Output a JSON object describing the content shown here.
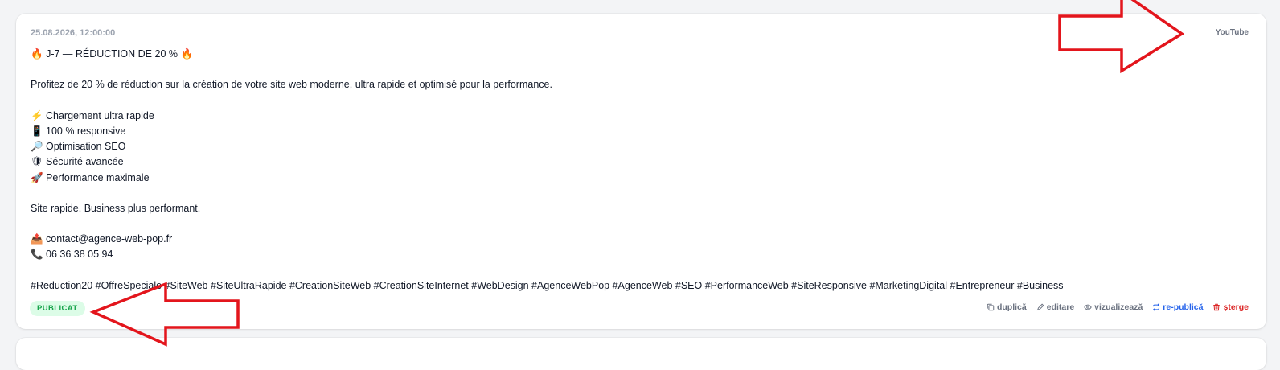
{
  "post": {
    "date": "25.08.2026, 12:00:00",
    "platform": "YouTube",
    "title": "J-7 — RÉDUCTION DE 20 %",
    "title_emoji": "🔥",
    "intro": "Profitez de 20 % de réduction sur la création de votre site web moderne, ultra rapide et optimisé pour la performance.",
    "features": [
      {
        "emoji": "⚡",
        "text": "Chargement ultra rapide"
      },
      {
        "emoji": "📱",
        "text": "100 % responsive"
      },
      {
        "emoji": "🔎",
        "text": "Optimisation SEO"
      },
      {
        "emoji": "🛡",
        "text": "Sécurité avancée"
      },
      {
        "emoji": "🚀",
        "text": "Performance maximale"
      }
    ],
    "tagline": "Site rapide. Business plus performant.",
    "contact_email": {
      "emoji": "📤",
      "text": "contact@agence-web-pop.fr"
    },
    "contact_phone": {
      "emoji": "📞",
      "text": "06 36 38 05 94"
    },
    "hashtags": "#Reduction20 #OffreSpeciale #SiteWeb #SiteUltraRapide #CreationSiteWeb #CreationSiteInternet #WebDesign #AgenceWebPop #AgenceWeb #SEO #PerformanceWeb #SiteResponsive #MarketingDigital #Entrepreneur #Business",
    "status": "PUBLICAT"
  },
  "actions": {
    "duplicate": "duplică",
    "edit": "editare",
    "view": "vizualizează",
    "republish": "re-publică",
    "delete": "șterge"
  },
  "colors": {
    "accent_blue": "#2563eb",
    "danger_red": "#dc2626",
    "status_green": "#16a34a",
    "annotation_red": "#e3151c"
  }
}
